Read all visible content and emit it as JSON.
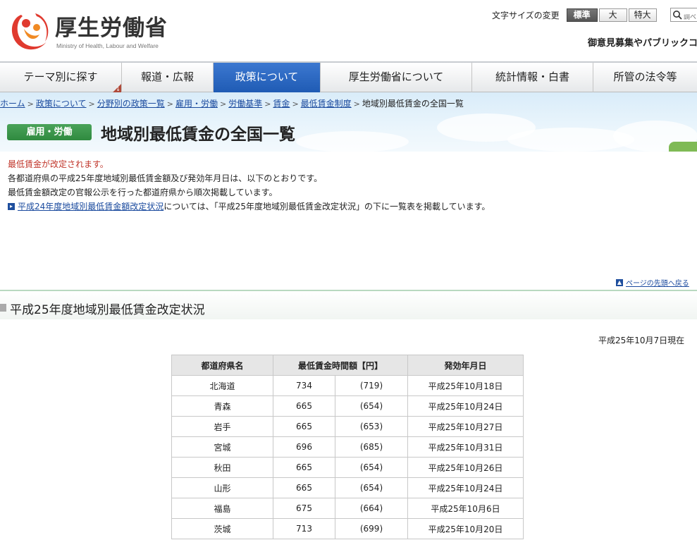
{
  "header": {
    "logo_title": "厚生労働省",
    "logo_subtitle": "Ministry of Health, Labour and Welfare",
    "font_size_label": "文字サイズの変更",
    "font_sizes": [
      "標準",
      "大",
      "特大"
    ],
    "search_placeholder": "調べ",
    "opinion_link": "御意見募集やパブリックコ"
  },
  "gnav": {
    "items": [
      "テーマ別に探す",
      "報道・広報",
      "政策について",
      "厚生労働省について",
      "統計情報・白書",
      "所管の法令等"
    ],
    "active_index": 2
  },
  "breadcrumb": {
    "links": [
      "ホーム",
      "政策について",
      "分野別の政策一覧",
      "雇用・労働",
      "労働基準",
      "賃金",
      "最低賃金制度"
    ],
    "current": "地域別最低賃金の全国一覧",
    "separator": ">"
  },
  "category_badge": "雇用・労働",
  "page_title": "地域別最低賃金の全国一覧",
  "intro": {
    "notice": "最低賃金が改定されます。",
    "line1": "各都道府県の平成25年度地域別最低賃金額及び発効年月日は、以下のとおりです。",
    "line2": "最低賃金額改定の官報公示を行った都道府県から順次掲載しています。",
    "link_text": "平成24年度地域別最低賃金額改定状況",
    "link_suffix": "については、「平成25年度地域別最低賃金改定状況」の下に一覧表を掲載しています。"
  },
  "to_top": "ページの先頭へ戻る",
  "section_title": "平成25年度地域別最低賃金改定状況",
  "as_of": "平成25年10月7日現在",
  "table": {
    "headers": [
      "都道府県名",
      "最低賃金時間額【円】",
      "発効年月日"
    ],
    "rows": [
      {
        "pref": "北海道",
        "wage": "734",
        "prev": "(719)",
        "date": "平成25年10月18日"
      },
      {
        "pref": "青森",
        "wage": "665",
        "prev": "(654)",
        "date": "平成25年10月24日"
      },
      {
        "pref": "岩手",
        "wage": "665",
        "prev": "(653)",
        "date": "平成25年10月27日"
      },
      {
        "pref": "宮城",
        "wage": "696",
        "prev": "(685)",
        "date": "平成25年10月31日"
      },
      {
        "pref": "秋田",
        "wage": "665",
        "prev": "(654)",
        "date": "平成25年10月26日"
      },
      {
        "pref": "山形",
        "wage": "665",
        "prev": "(654)",
        "date": "平成25年10月24日"
      },
      {
        "pref": "福島",
        "wage": "675",
        "prev": "(664)",
        "date": "平成25年10月6日"
      },
      {
        "pref": "茨城",
        "wage": "713",
        "prev": "(699)",
        "date": "平成25年10月20日"
      }
    ]
  },
  "colors": {
    "nav_active": "#2a66c2",
    "notice_red": "#c0352a",
    "category_green": "#3a9a4a",
    "link_blue": "#1a4a9e"
  }
}
